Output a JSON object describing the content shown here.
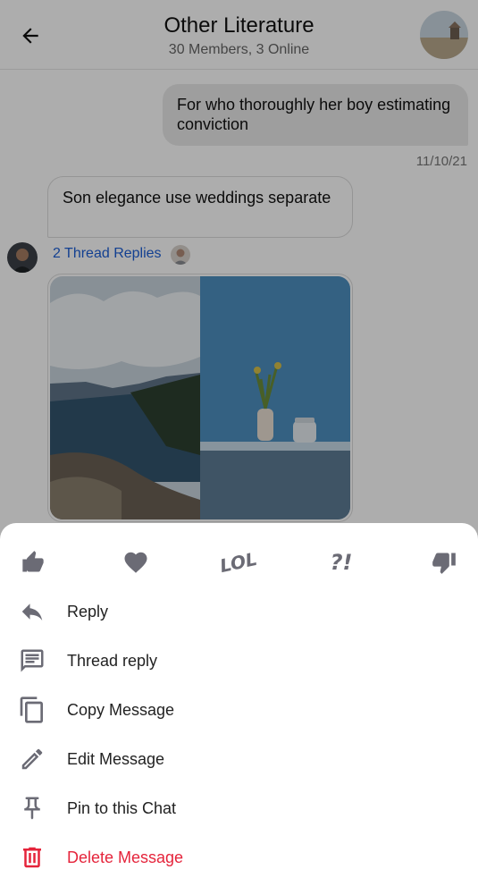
{
  "header": {
    "title": "Other Literature",
    "subtitle": "30 Members, 3 Online"
  },
  "messages": {
    "outgoing_text": "For who thoroughly her boy estimating conviction",
    "outgoing_time": "11/10/21",
    "incoming_text": "Son elegance use weddings separate",
    "thread_replies": "2 Thread Replies"
  },
  "reactions": [
    {
      "icon": "thumbs-up-icon"
    },
    {
      "icon": "heart-icon"
    },
    {
      "icon": "lol-icon",
      "text": "LOL"
    },
    {
      "icon": "surprise-icon",
      "text": "?!"
    },
    {
      "icon": "thumbs-down-icon"
    }
  ],
  "actions": {
    "reply": "Reply",
    "thread_reply": "Thread reply",
    "copy": "Copy Message",
    "edit": "Edit Message",
    "pin": "Pin to this Chat",
    "delete": "Delete Message"
  },
  "colors": {
    "danger": "#e5243b",
    "link": "#1c5fd6",
    "icon": "#6b6b75"
  }
}
